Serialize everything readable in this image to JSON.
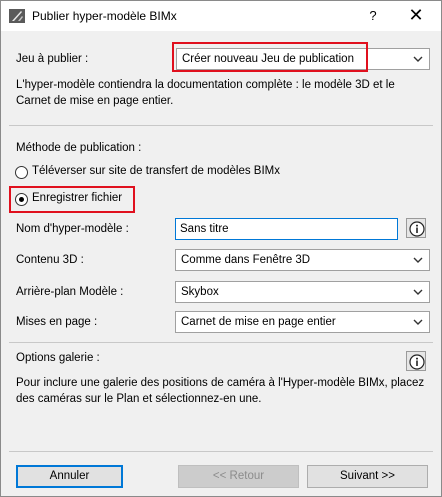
{
  "window": {
    "title": "Publier hyper-modèle BIMx",
    "help_label": "?",
    "close_label": "✕"
  },
  "publish_set": {
    "label": "Jeu à publier :",
    "selected": "Créer nouveau Jeu de publication",
    "description": "L'hyper-modèle contiendra la documentation complète : le modèle 3D et le Carnet de mise en page entier."
  },
  "method": {
    "label": "Méthode de publication :",
    "options": [
      {
        "label": "Téléverser sur site de transfert de modèles BIMx",
        "checked": false
      },
      {
        "label": "Enregistrer fichier",
        "checked": true
      }
    ]
  },
  "fields": {
    "name_label": "Nom d'hyper-modèle :",
    "name_value": "Sans titre",
    "content3d_label": "Contenu 3D :",
    "content3d_value": "Comme dans Fenêtre 3D",
    "background_label": "Arrière-plan Modèle :",
    "background_value": "Skybox",
    "layouts_label": "Mises en page :",
    "layouts_value": "Carnet de mise en page entier"
  },
  "gallery": {
    "label": "Options galerie :",
    "description": "Pour inclure une galerie des positions de caméra à l'Hyper-modèle BIMx, placez des caméras sur le Plan et sélectionnez-en une."
  },
  "buttons": {
    "cancel": "Annuler",
    "back": "<< Retour",
    "next": "Suivant >>"
  },
  "colors": {
    "highlight": "#e0101e",
    "focus": "#0078d7"
  }
}
